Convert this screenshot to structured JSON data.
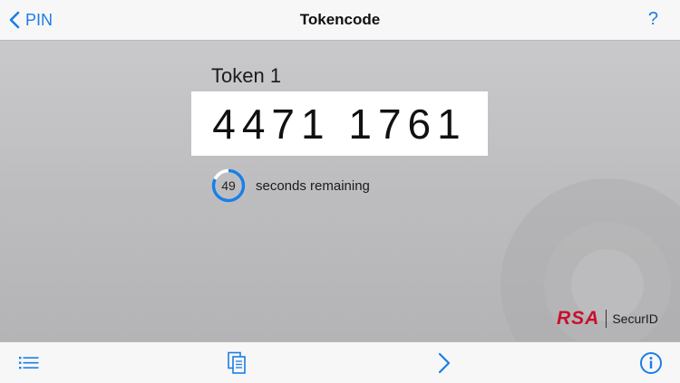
{
  "navbar": {
    "back_label": "PIN",
    "title": "Tokencode",
    "help_label": "?"
  },
  "token": {
    "name": "Token 1",
    "code": "4471 1761",
    "seconds": "49",
    "seconds_fraction": 0.82,
    "seconds_label": "seconds remaining"
  },
  "brand": {
    "mark": "RSA",
    "product": "SecurID"
  },
  "toolbar": {
    "icons": [
      "list-icon",
      "copy-icon",
      "next-icon",
      "info-icon"
    ]
  },
  "colors": {
    "accent": "#1a7ee6",
    "brand_red": "#c8102e",
    "timer_ring": "#1a7ee6"
  }
}
